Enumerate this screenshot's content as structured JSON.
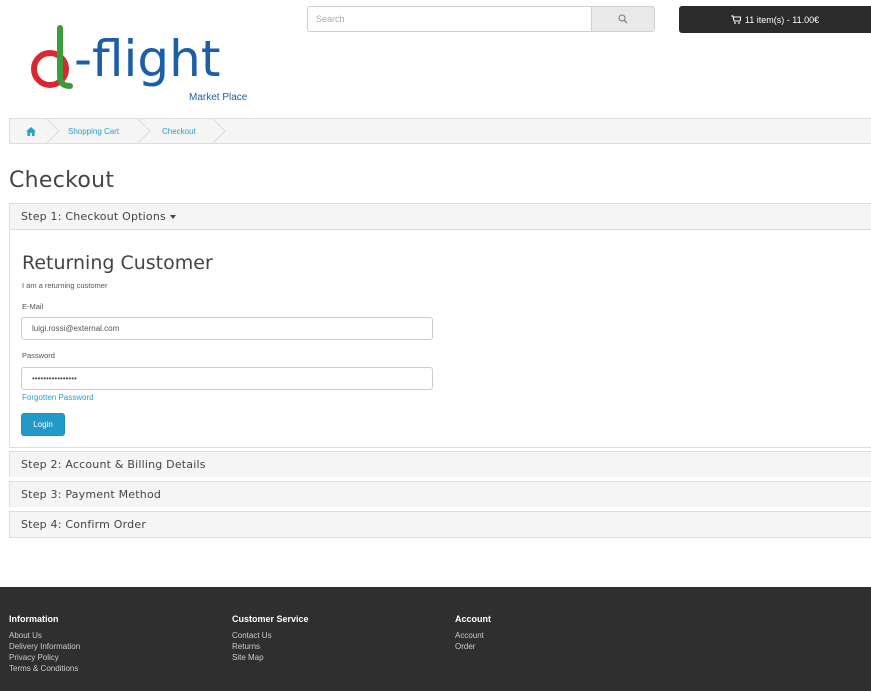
{
  "header": {
    "logo_text": "d-flight",
    "logo_subtitle": "Market Place",
    "search_placeholder": "Search",
    "cart_label": "11 item(s) - 11.00€"
  },
  "breadcrumb": [
    "Shopping Cart",
    "Checkout"
  ],
  "page_title": "Checkout",
  "steps": {
    "step1": "Step 1: Checkout Options",
    "step2": "Step 2: Account & Billing Details",
    "step3": "Step 3: Payment Method",
    "step4": "Step 4: Confirm Order"
  },
  "returning": {
    "title": "Returning Customer",
    "note": "I am a returning customer",
    "email_label": "E-Mail",
    "email_value": "luigi.rossi@external.com",
    "password_label": "Password",
    "password_value": "••••••••••••••••",
    "forgot_label": "Forgotten Password",
    "login_label": "Login"
  },
  "footer": {
    "information": {
      "title": "Information",
      "links": [
        "About Us",
        "Delivery Information",
        "Privacy Policy",
        "Terms & Conditions"
      ]
    },
    "customer_service": {
      "title": "Customer Service",
      "links": [
        "Contact Us",
        "Returns",
        "Site Map"
      ]
    },
    "account": {
      "title": "Account",
      "links": [
        "Account",
        "Order"
      ]
    }
  },
  "colors": {
    "accent": "#229ac8",
    "link": "#23a1d1",
    "logo_red": "#d9282f",
    "logo_green": "#3a9d3a",
    "logo_blue": "#1b5fa8",
    "footer_bg": "#2f2f2f"
  }
}
